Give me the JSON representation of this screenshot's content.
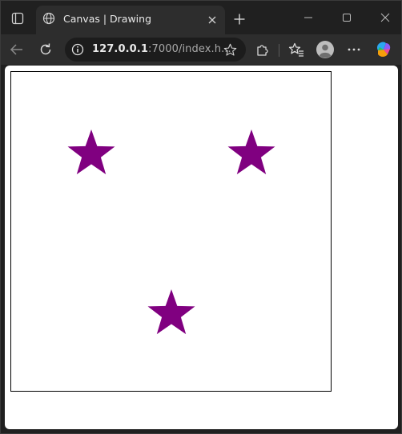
{
  "browser": {
    "tab": {
      "title": "Canvas | Drawing",
      "favicon_icon": "globe-icon",
      "close_icon": "close-icon"
    },
    "new_tab_icon": "plus-icon",
    "window_controls": [
      "minimize-icon",
      "maximize-icon",
      "close-icon"
    ],
    "toolbar": {
      "back_icon": "arrow-left-icon",
      "reload_icon": "reload-icon",
      "site_info_icon": "info-icon",
      "url_host": "127.0.0.1",
      "url_rest": ":7000/index.h...",
      "favorite_icon": "star-outline-icon",
      "extensions_icon": "puzzle-icon",
      "favorites_icon": "favorites-icon",
      "profile_icon": "avatar",
      "menu_icon": "more-icon",
      "copilot_icon": "copilot-icon"
    }
  },
  "page": {
    "canvas": {
      "border_color": "#000000",
      "background": "#ffffff",
      "shapes": [
        {
          "type": "star",
          "color": "#800080"
        },
        {
          "type": "star",
          "color": "#800080"
        },
        {
          "type": "star",
          "color": "#800080"
        }
      ]
    }
  }
}
